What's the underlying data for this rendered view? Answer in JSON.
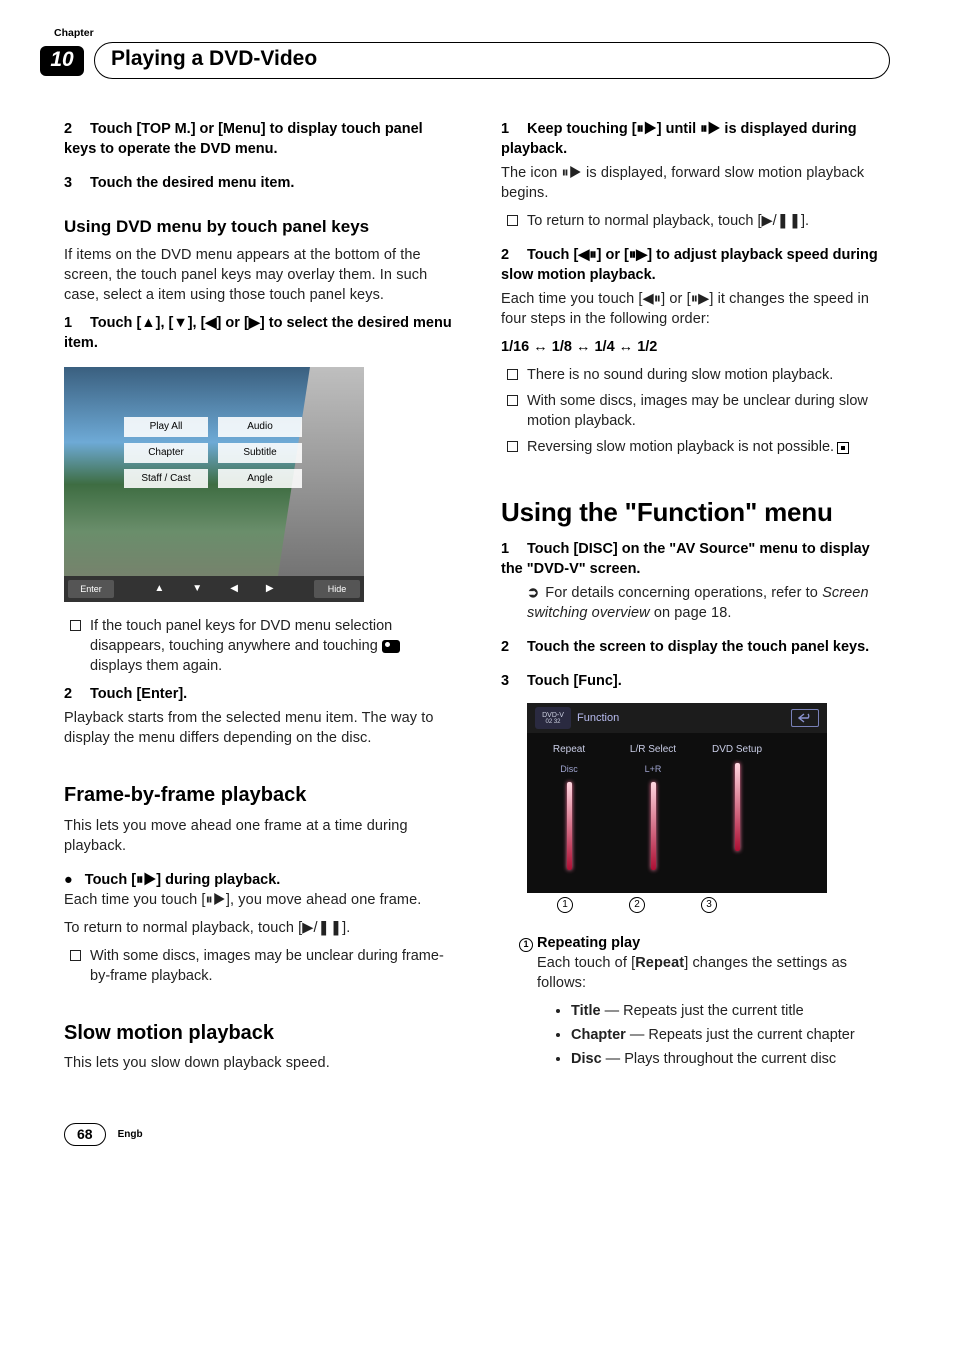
{
  "chapter_label": "Chapter",
  "chapter_num": "10",
  "chapter_title": "Playing a DVD-Video",
  "left": {
    "step2": "Touch [TOP M.] or [Menu] to display touch panel keys to operate the DVD menu.",
    "step3": "Touch the desired menu item.",
    "sub1_title": "Using DVD menu by touch panel keys",
    "sub1_para": "If items on the DVD menu appears at the bottom of the screen, the touch panel keys may overlay them. In such case, select a item using those touch panel keys.",
    "sub1_step1": "Touch [▲], [▼], [◀] or [▶] to select the desired menu item.",
    "dvd_menu": {
      "items": [
        "Play All",
        "Audio",
        "Chapter",
        "Subtitle",
        "Staff / Cast",
        "Angle"
      ],
      "enter": "Enter",
      "hide": "Hide",
      "arrows": [
        "▲",
        "▼",
        "◀",
        "▶"
      ]
    },
    "sub1_note1": "If the touch panel keys for DVD menu selection disappears, touching anywhere and touching ",
    "sub1_note1b": " displays them again.",
    "sub1_step2_label": "Touch [Enter].",
    "sub1_step2_body": "Playback starts from the selected menu item. The way to display the menu differs depending on the disc.",
    "sec2_title": "Frame-by-frame playback",
    "sec2_intro": "This lets you move ahead one frame at a time during playback.",
    "sec2_bullet_label": "Touch [⏸▶] during playback.",
    "sec2_body1": "Each time you touch [⏸▶], you move ahead one frame.",
    "sec2_body2": "To return to normal playback, touch [▶/❚❚].",
    "sec2_note": "With some discs, images may be unclear during frame-by-frame playback.",
    "sec3_title": "Slow motion playback",
    "sec3_intro": "This lets you slow down playback speed."
  },
  "right": {
    "step1": "Keep touching [⏸▶] until ⏸▶ is displayed during playback.",
    "step1_body": "The icon ⏸▶ is displayed, forward slow motion playback begins.",
    "step1_note": "To return to normal playback, touch [▶/❚❚].",
    "step2": "Touch [◀⏸] or [⏸▶] to adjust playback speed during slow motion playback.",
    "step2_body": "Each time you touch [◀⏸] or [⏸▶] it changes the speed in four steps in the following order:",
    "speed_line": "1/16 ↔ 1/8 ↔ 1/4 ↔ 1/2",
    "step2_notes": [
      "There is no sound during slow motion playback.",
      "With some discs, images may be unclear during slow motion playback.",
      "Reversing slow motion playback is not possible."
    ],
    "main2_pre": "Using the \"",
    "main2_mid": "Function",
    "main2_suf": "\" menu",
    "m2_step1": "Touch [DISC] on the \"AV Source\" menu to display the \"DVD-V\" screen.",
    "m2_step1_ref_pre": "For details concerning operations, refer to ",
    "m2_step1_ref_it": "Screen switching overview",
    "m2_step1_ref_suf": " on page 18.",
    "m2_step2": "Touch the screen to display the touch panel keys.",
    "m2_step3": "Touch [Func].",
    "func": {
      "badge_top": "DVD-V",
      "badge_bottom": "02 32",
      "title": "Function",
      "cols": [
        {
          "label": "Repeat",
          "val": "Disc"
        },
        {
          "label": "L/R Select",
          "val": "L+R"
        },
        {
          "label": "DVD Setup",
          "val": ""
        }
      ],
      "callouts": [
        "1",
        "2",
        "3"
      ]
    },
    "rep_title": "Repeating play",
    "rep_intro_pre": "Each touch of [",
    "rep_intro_bold": "Repeat",
    "rep_intro_suf": "] changes the settings as follows:",
    "rep_items": [
      {
        "b": "Title",
        "t": " — Repeats just the current title"
      },
      {
        "b": "Chapter",
        "t": " — Repeats just the current chapter"
      },
      {
        "b": "Disc",
        "t": " — Plays throughout the current disc"
      }
    ]
  },
  "page_num": "68",
  "lang": "Engb"
}
